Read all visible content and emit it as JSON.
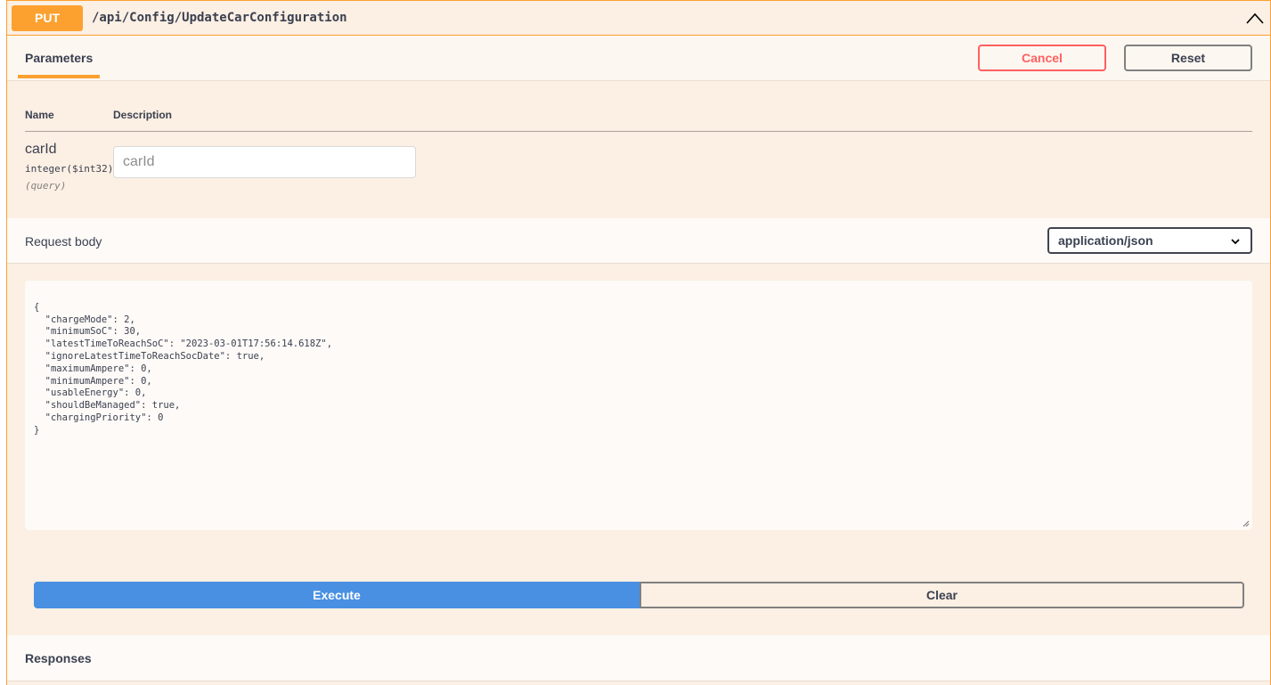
{
  "operation": {
    "method": "PUT",
    "path": "/api/Config/UpdateCarConfiguration",
    "accent_color": "#fca130"
  },
  "tabs": {
    "parameters_label": "Parameters",
    "cancel_label": "Cancel",
    "reset_label": "Reset"
  },
  "params_table": {
    "col_name": "Name",
    "col_description": "Description",
    "param": {
      "name": "carId",
      "type": "integer($int32)",
      "in": "(query)",
      "placeholder": "carId",
      "value": ""
    }
  },
  "request_body": {
    "title": "Request body",
    "content_type": "application/json",
    "lines": [
      "{",
      "  \"chargeMode\": 2,",
      "  \"minimumSoC\": 30,",
      "  \"latestTimeToReachSoC\": \"2023-03-01T17:56:14.618Z\",",
      "  \"ignoreLatestTimeToReachSocDate\": true,",
      "  \"maximumAmpere\": 0,",
      "  \"minimumAmpere\": 0,",
      "  \"usableEnergy\": 0,",
      "  \"shouldBeManaged\": true,",
      "  \"chargingPriority\": 0",
      "}"
    ]
  },
  "actions": {
    "execute_label": "Execute",
    "clear_label": "Clear",
    "execute_color": "#4990e2"
  },
  "responses": {
    "title": "Responses"
  },
  "icons": {
    "collapse": "chevron-up-icon",
    "select": "chevron-down-icon"
  }
}
